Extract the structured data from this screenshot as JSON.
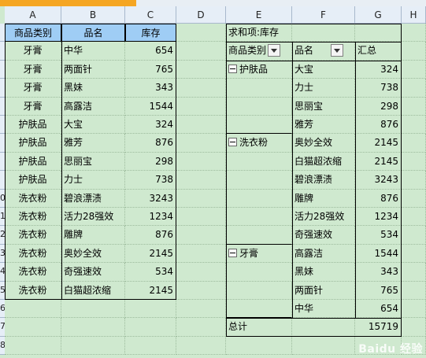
{
  "columns": [
    "A",
    "B",
    "C",
    "D",
    "E",
    "F",
    "G",
    "H"
  ],
  "rows": [
    "",
    "",
    "",
    "",
    "",
    "",
    "",
    "",
    "",
    "0",
    "1",
    "2",
    "3",
    "4",
    "5",
    "6",
    "7",
    "8"
  ],
  "source_table": {
    "headers": [
      "商品类别",
      "品名",
      "库存"
    ],
    "rows": [
      [
        "牙膏",
        "中华",
        "654"
      ],
      [
        "牙膏",
        "两面针",
        "765"
      ],
      [
        "牙膏",
        "黑妹",
        "343"
      ],
      [
        "牙膏",
        "高露洁",
        "1544"
      ],
      [
        "护肤品",
        "大宝",
        "324"
      ],
      [
        "护肤品",
        "雅芳",
        "876"
      ],
      [
        "护肤品",
        "思丽宝",
        "298"
      ],
      [
        "护肤品",
        "力士",
        "738"
      ],
      [
        "洗衣粉",
        "碧浪漂渍",
        "3243"
      ],
      [
        "洗衣粉",
        "活力28强效",
        "1234"
      ],
      [
        "洗衣粉",
        "雕牌",
        "876"
      ],
      [
        "洗衣粉",
        "奥妙全效",
        "2145"
      ],
      [
        "洗衣粉",
        "奇强速效",
        "534"
      ],
      [
        "洗衣粉",
        "白猫超浓缩",
        "2145"
      ]
    ]
  },
  "pivot": {
    "title": "求和项:库存",
    "header_category": "商品类别",
    "header_name": "品名",
    "header_total": "汇总",
    "groups": [
      {
        "label": "护肤品",
        "items": [
          [
            "大宝",
            "324"
          ],
          [
            "力士",
            "738"
          ],
          [
            "思丽宝",
            "298"
          ],
          [
            "雅芳",
            "876"
          ]
        ]
      },
      {
        "label": "洗衣粉",
        "items": [
          [
            "奥妙全效",
            "2145"
          ],
          [
            "白猫超浓缩",
            "2145"
          ],
          [
            "碧浪漂渍",
            "3243"
          ],
          [
            "雕牌",
            "876"
          ],
          [
            "活力28强效",
            "1234"
          ],
          [
            "奇强速效",
            "534"
          ]
        ]
      },
      {
        "label": "牙膏",
        "items": [
          [
            "高露洁",
            "1544"
          ],
          [
            "黑妹",
            "343"
          ],
          [
            "两面针",
            "765"
          ],
          [
            "中华",
            "654"
          ]
        ]
      }
    ],
    "grand_total_label": "总计",
    "grand_total_value": "15719"
  },
  "watermark": "Baidu 经验",
  "colors": {
    "header_fill": "#9fcdf5",
    "sheet_bg": "#cfe9cf"
  }
}
